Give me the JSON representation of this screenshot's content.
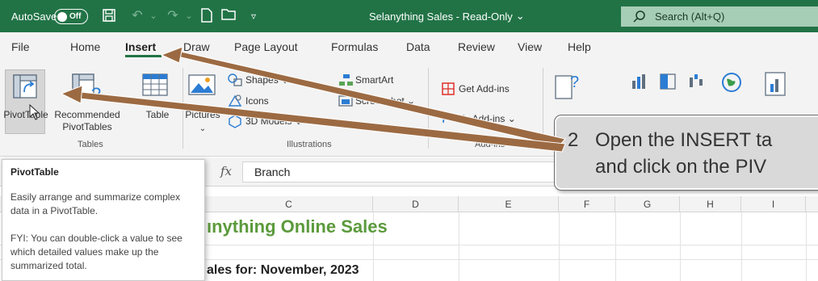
{
  "titlebar": {
    "autosave_label": "AutoSave",
    "autosave_state": "Off",
    "document_title": "Selanything Sales  -  Read-Only",
    "search_placeholder": "Search (Alt+Q)",
    "bg_color": "#217346",
    "qat_icons": [
      "save-icon",
      "undo-icon",
      "redo-icon",
      "new-file-icon",
      "open-folder-icon",
      "customize-qat-icon"
    ]
  },
  "ribbon": {
    "tabs": [
      "File",
      "Home",
      "Insert",
      "Draw",
      "Page Layout",
      "Formulas",
      "Data",
      "Review",
      "View",
      "Help"
    ],
    "active_tab": "Insert",
    "tables_group": {
      "label": "Tables",
      "pivot_label": "PivotTable",
      "recommended_line1": "Recommended",
      "recommended_line2": "PivotTables",
      "table_label": "Table"
    },
    "illustrations_group": {
      "label": "Illustrations",
      "pictures_label": "Pictures",
      "shapes_label": "Shapes",
      "icons_label": "Icons",
      "models_label": "3D Models",
      "smartart_label": "SmartArt",
      "screenshot_label": "Screenshot"
    },
    "addins_group": {
      "label": "Add-ins",
      "get_label": "Get Add-ins",
      "my_label": "My Add-ins"
    }
  },
  "formula_bar": {
    "fx_label": "fx",
    "value": "Branch"
  },
  "sheet": {
    "columns": [
      "C",
      "D",
      "E",
      "F",
      "G",
      "H",
      "I"
    ],
    "title_visible": "ınything Online Sales",
    "subtitle_visible": "ales for: November, 2023",
    "title_color": "#5b9a3c"
  },
  "tooltip": {
    "title": "PivotTable",
    "line1": "Easily arrange and summarize complex data in a PivotTable.",
    "line2": "FYI: You can double-click a value to see which detailed values make up the summarized total."
  },
  "callout": {
    "number": "2",
    "line1": "Open the INSERT ta",
    "line2": "and click on the PIV",
    "arrow_color": "#9c6a42"
  }
}
